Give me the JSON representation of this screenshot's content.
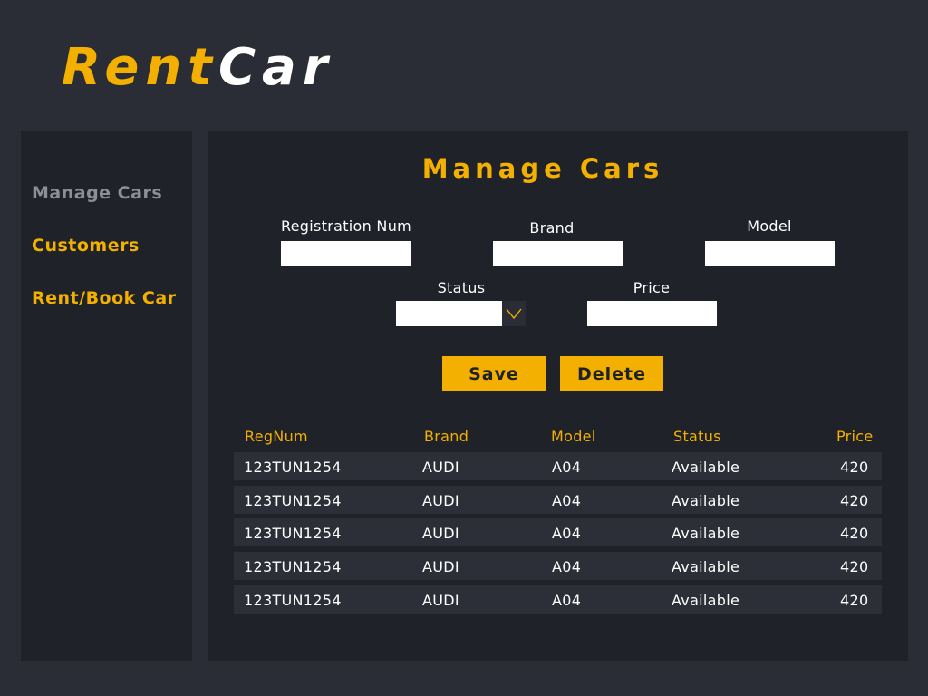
{
  "brand": {
    "part1": "Rent",
    "part2": "Car"
  },
  "sidebar": {
    "items": [
      {
        "label": "Manage Cars"
      },
      {
        "label": "Customers"
      },
      {
        "label": "Rent/Book Car"
      }
    ]
  },
  "main": {
    "title": "Manage Cars",
    "form": {
      "registration_label": "Registration Num",
      "registration_value": "",
      "brand_label": "Brand",
      "brand_value": "",
      "model_label": "Model",
      "model_value": "",
      "status_label": "Status",
      "status_value": "",
      "price_label": "Price",
      "price_value": ""
    },
    "buttons": {
      "save": "Save",
      "delete": "Delete"
    },
    "table": {
      "headers": [
        "RegNum",
        "Brand",
        "Model",
        "Status",
        "Price"
      ],
      "rows": [
        [
          "123TUN1254",
          "AUDI",
          "A04",
          "Available",
          "420"
        ],
        [
          "123TUN1254",
          "AUDI",
          "A04",
          "Available",
          "420"
        ],
        [
          "123TUN1254",
          "AUDI",
          "A04",
          "Available",
          "420"
        ],
        [
          "123TUN1254",
          "AUDI",
          "A04",
          "Available",
          "420"
        ],
        [
          "123TUN1254",
          "AUDI",
          "A04",
          "Available",
          "420"
        ]
      ]
    }
  },
  "colors": {
    "accent": "#f3b000",
    "background": "#2a2d35",
    "panel": "#1f2229",
    "row": "#2c2f37"
  },
  "icons": {
    "status_dropdown": "chevron-down-icon"
  }
}
